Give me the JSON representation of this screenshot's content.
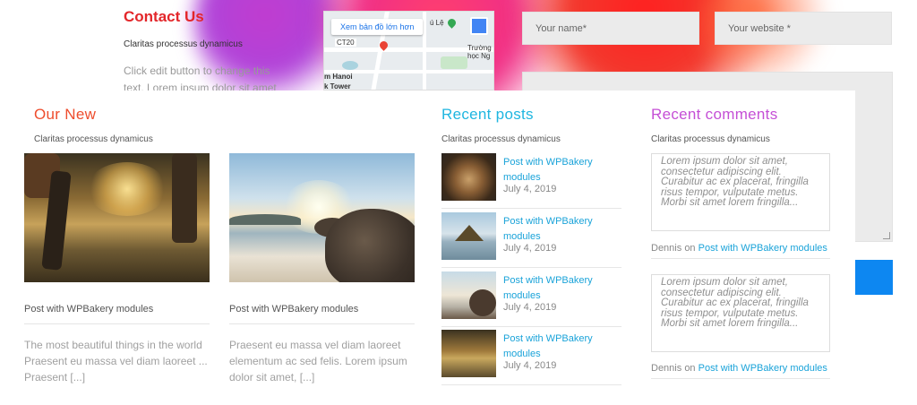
{
  "contact": {
    "title": "Contact Us",
    "subtitle": "Claritas processus dynamicus",
    "body": "Click edit button to change this text. Lorem ipsum dolor sit amet"
  },
  "map": {
    "link_label": "Xem bản đồ lớn hơn",
    "labels": [
      "ú Lệ",
      "CT20",
      "Trường học Ng",
      "m Hanoi",
      "k Tower"
    ]
  },
  "form": {
    "name_placeholder": "Your name*",
    "website_placeholder": "Your website *"
  },
  "our_new": {
    "title": "Our New",
    "subtitle": "Claritas processus dynamicus",
    "cards": [
      {
        "title": "Post with WPBakery modules",
        "excerpt": "The most beautiful things in the world Praesent eu massa vel diam laoreet ... Praesent [...]"
      },
      {
        "title": "Post with WPBakery modules",
        "excerpt": "Praesent eu massa vel diam laoreet elementum ac sed felis. Lorem ipsum dolor sit amet, [...]"
      }
    ]
  },
  "recent_posts": {
    "title": "Recent posts",
    "subtitle": "Claritas processus dynamicus",
    "items": [
      {
        "title": "Post with WPBakery modules",
        "date": "July 4, 2019"
      },
      {
        "title": "Post with WPBakery modules",
        "date": "July 4, 2019"
      },
      {
        "title": "Post with WPBakery modules",
        "date": "July 4, 2019"
      },
      {
        "title": "Post with WPBakery modules",
        "date": "July 4, 2019"
      }
    ]
  },
  "recent_comments": {
    "title": "Recent comments",
    "subtitle": "Claritas processus dynamicus",
    "items": [
      {
        "text": "Lorem ipsum dolor sit amet, consectetur adipiscing elit. Curabitur ac ex placerat, fringilla risus tempor, vulputate metus. Morbi sit amet lorem fringilla...",
        "author": "Dennis",
        "on": "on",
        "post": "Post with WPBakery modules"
      },
      {
        "text": "Lorem ipsum dolor sit amet, consectetur adipiscing elit. Curabitur ac ex placerat, fringilla risus tempor, vulputate metus. Morbi sit amet lorem fringilla...",
        "author": "Dennis",
        "on": "on",
        "post": "Post with WPBakery modules"
      }
    ]
  },
  "colors": {
    "our_new_title": "#ee4d2d",
    "recent_posts_title": "#1fb6e0",
    "recent_comments_title": "#c54fd6",
    "contact_title": "#e3262a",
    "link": "#1aa3d9",
    "submit": "#0d87f1"
  }
}
